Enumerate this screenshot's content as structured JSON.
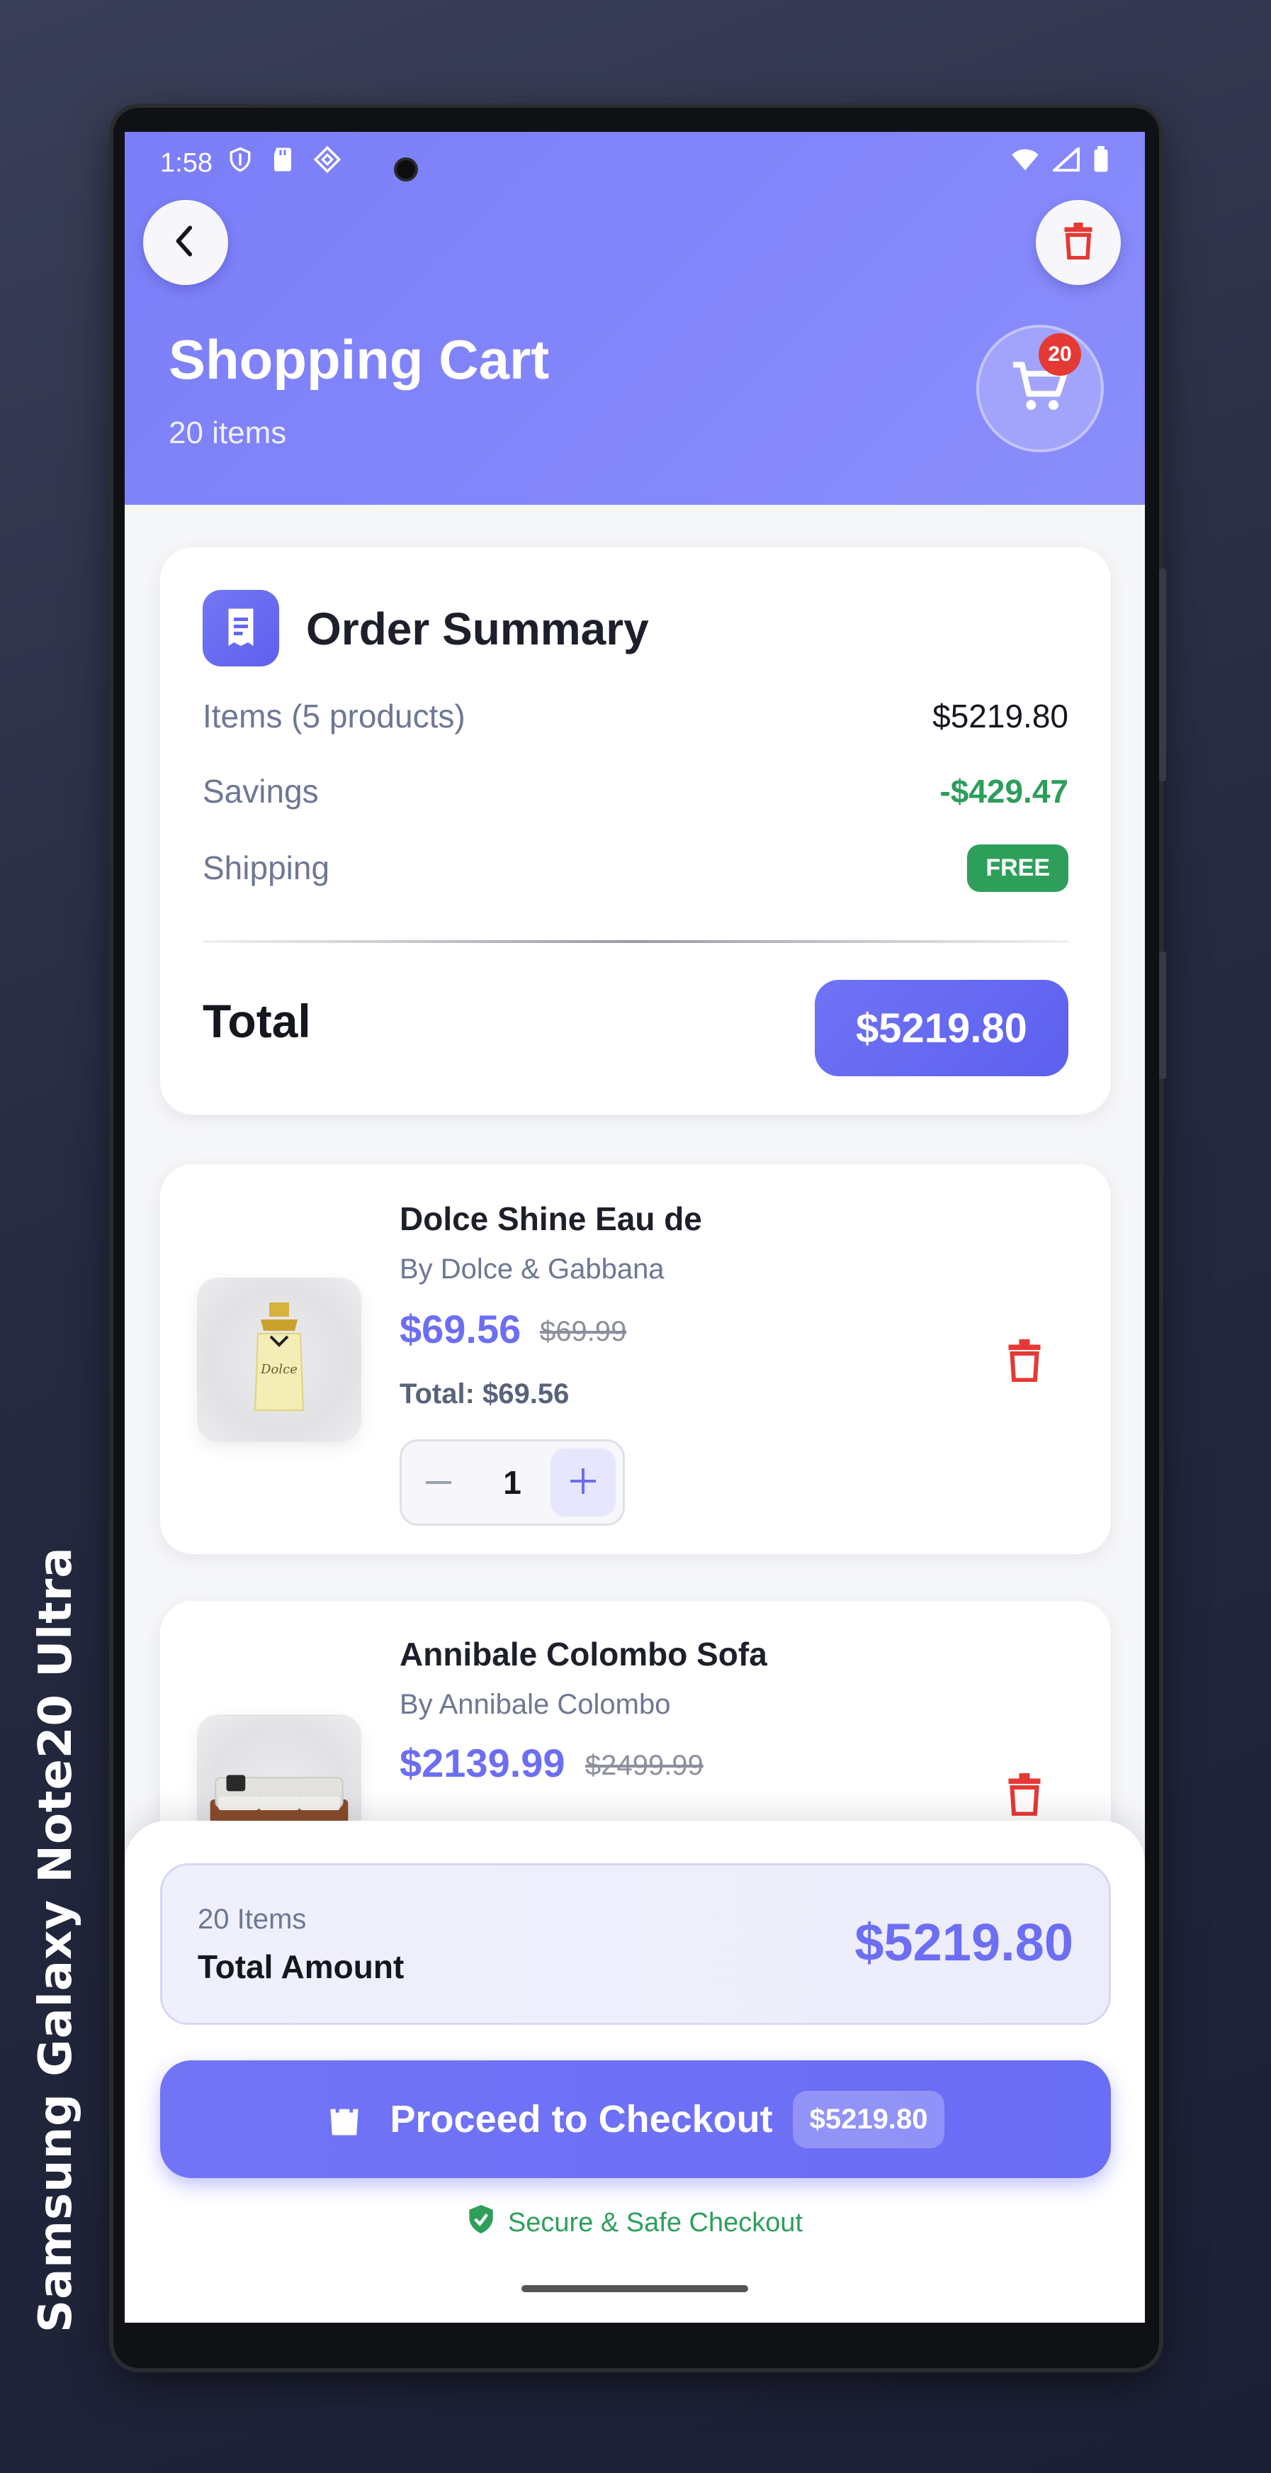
{
  "device": {
    "label": "Samsung Galaxy  Note20 Ultra"
  },
  "status_bar": {
    "time": "1:58"
  },
  "header": {
    "title": "Shopping Cart",
    "subtitle": "20 items",
    "cart_badge": "20"
  },
  "summary": {
    "title": "Order Summary",
    "rows": [
      {
        "label": "Items (5 products)",
        "value": "$5219.80"
      },
      {
        "label": "Savings",
        "value": "-$429.47"
      },
      {
        "label": "Shipping",
        "value": "FREE"
      }
    ],
    "total_label": "Total",
    "total_value": "$5219.80"
  },
  "items": [
    {
      "name": "Dolce Shine Eau de",
      "brand": "By Dolce & Gabbana",
      "price": "$69.56",
      "old_price": "$69.99",
      "total": "Total: $69.56",
      "qty": "1"
    },
    {
      "name": "Annibale Colombo Sofa",
      "brand": "By Annibale Colombo",
      "price": "$2139.99",
      "old_price": "$2499.99"
    }
  ],
  "footer": {
    "items_count": "20 Items",
    "amount_label": "Total Amount",
    "amount_value": "$5219.80",
    "checkout_label": "Proceed to Checkout",
    "checkout_amount": "$5219.80",
    "secure_text": "Secure & Safe Checkout"
  },
  "colors": {
    "accent": "#6c6ef3",
    "header": "#7b7ef8",
    "green": "#2e9f5b",
    "danger": "#e53935"
  }
}
